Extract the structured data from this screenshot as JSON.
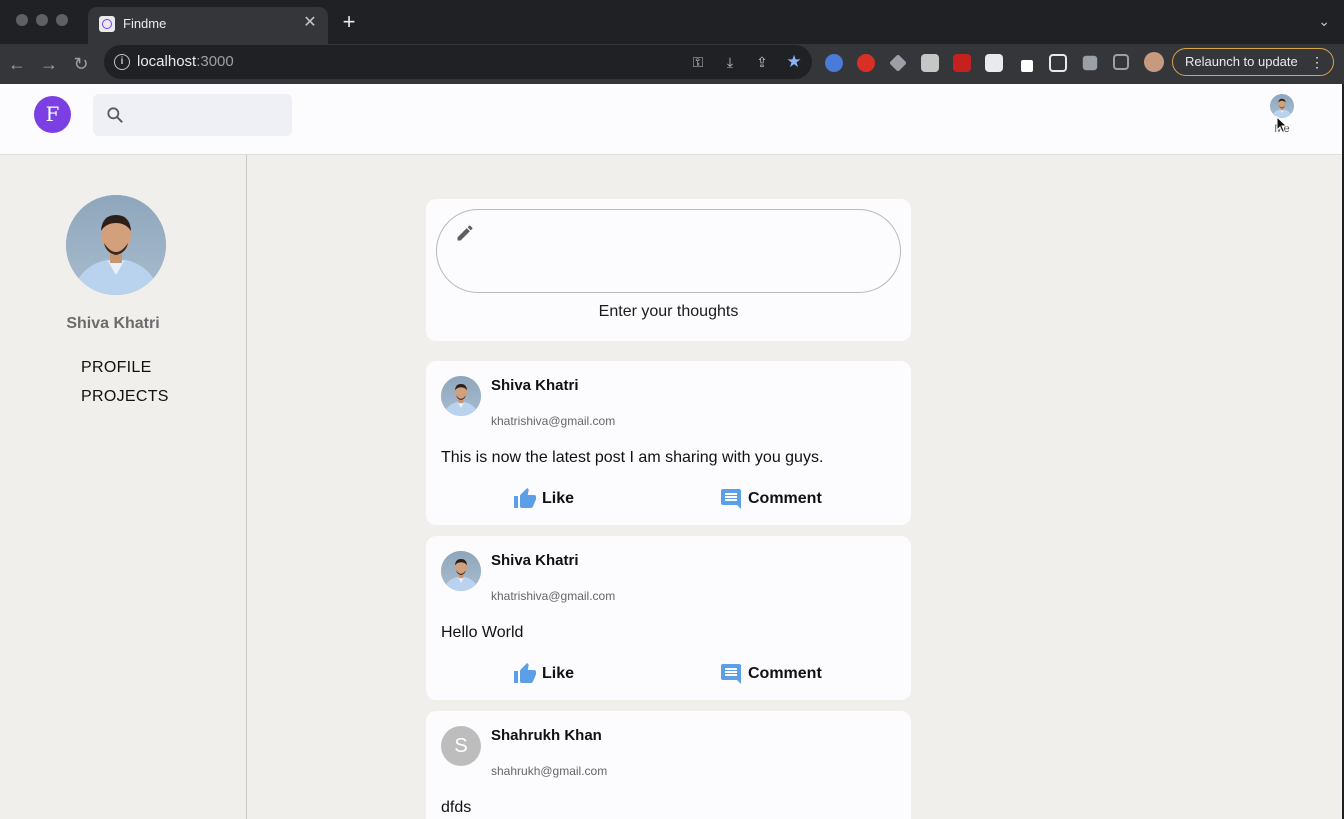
{
  "browser": {
    "tab_title": "Findme",
    "tab_close": "✕",
    "new_tab": "+",
    "url_host": "localhost",
    "url_port": ":3000",
    "relaunch_label": "Relaunch to update"
  },
  "appbar": {
    "logo_letter": "F",
    "search_placeholder": "",
    "me_label": "Me"
  },
  "sidebar": {
    "user_name": "Shiva Khatri",
    "links": [
      "PROFILE",
      "PROJECTS"
    ]
  },
  "composer": {
    "label": "Enter your thoughts"
  },
  "posts": [
    {
      "author": "Shiva Khatri",
      "email": "khatrishiva@gmail.com",
      "text": "This is now the latest post I am sharing with you guys.",
      "like_label": "Like",
      "comment_label": "Comment"
    },
    {
      "author": "Shiva Khatri",
      "email": "khatrishiva@gmail.com",
      "text": "Hello World",
      "like_label": "Like",
      "comment_label": "Comment"
    },
    {
      "author": "Shahrukh Khan",
      "email": "shahrukh@gmail.com",
      "text": "dfds",
      "avatar_letter": "S"
    }
  ],
  "colors": {
    "brand": "#7b3fe4",
    "action_icon": "#5b9fe6",
    "page_bg": "#f0efec",
    "card_bg": "#fcfbfd"
  }
}
